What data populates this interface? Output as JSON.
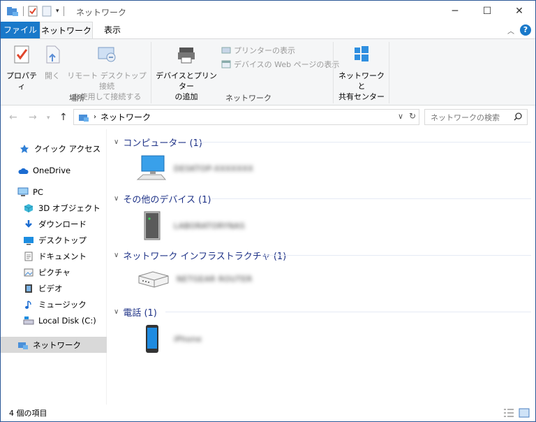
{
  "window": {
    "title": "ネットワーク",
    "controls": {
      "minimize": "─",
      "maximize": "☐",
      "close": "✕"
    }
  },
  "ribbon_tabs": [
    {
      "label": "ファイル"
    },
    {
      "label": "ネットワーク"
    },
    {
      "label": "表示"
    }
  ],
  "ribbon": {
    "properties": "プロパティ",
    "open": "開く",
    "remote_desktop_1": "リモート デスクトップ接続",
    "remote_desktop_2": "を使用して接続する",
    "group_location": "場所",
    "add_devices_1": "デバイスとプリンター",
    "add_devices_2": "の追加",
    "show_printers": "プリンターの表示",
    "show_web_page": "デバイスの Web ページの表示",
    "group_network": "ネットワーク",
    "network_center_1": "ネットワークと",
    "network_center_2": "共有センター",
    "help": "?"
  },
  "address": {
    "crumb": "ネットワーク",
    "search_placeholder": "ネットワークの検索"
  },
  "sidebar": {
    "items": [
      {
        "label": "クイック アクセス",
        "icon": "star-icon"
      },
      {
        "label": "OneDrive",
        "icon": "cloud-icon"
      },
      {
        "label": "PC",
        "icon": "pc-icon"
      },
      {
        "label": "3D オブジェクト",
        "icon": "cube-icon"
      },
      {
        "label": "ダウンロード",
        "icon": "download-icon"
      },
      {
        "label": "デスクトップ",
        "icon": "desktop-icon"
      },
      {
        "label": "ドキュメント",
        "icon": "document-icon"
      },
      {
        "label": "ピクチャ",
        "icon": "picture-icon"
      },
      {
        "label": "ビデオ",
        "icon": "video-icon"
      },
      {
        "label": "ミュージック",
        "icon": "music-icon"
      },
      {
        "label": "Local Disk (C:)",
        "icon": "disk-icon"
      },
      {
        "label": "ネットワーク",
        "icon": "network-icon"
      }
    ]
  },
  "groups": [
    {
      "label": "コンピューター (1)",
      "device": "DESKTOP-XXXXXXX",
      "icon": "computer-icon"
    },
    {
      "label": "その他のデバイス (1)",
      "device": "LABORATORYNAS",
      "icon": "server-icon"
    },
    {
      "label": "ネットワーク インフラストラクチャ (1)",
      "device": "NETGEAR ROUTER",
      "icon": "router-icon"
    },
    {
      "label": "電話 (1)",
      "device": "iPhone",
      "icon": "phone-icon"
    }
  ],
  "status": {
    "count": "4 個の項目"
  },
  "colors": {
    "accent": "#1979ca",
    "group_header": "#1e3287",
    "selected_bg": "#d9d9d9"
  }
}
